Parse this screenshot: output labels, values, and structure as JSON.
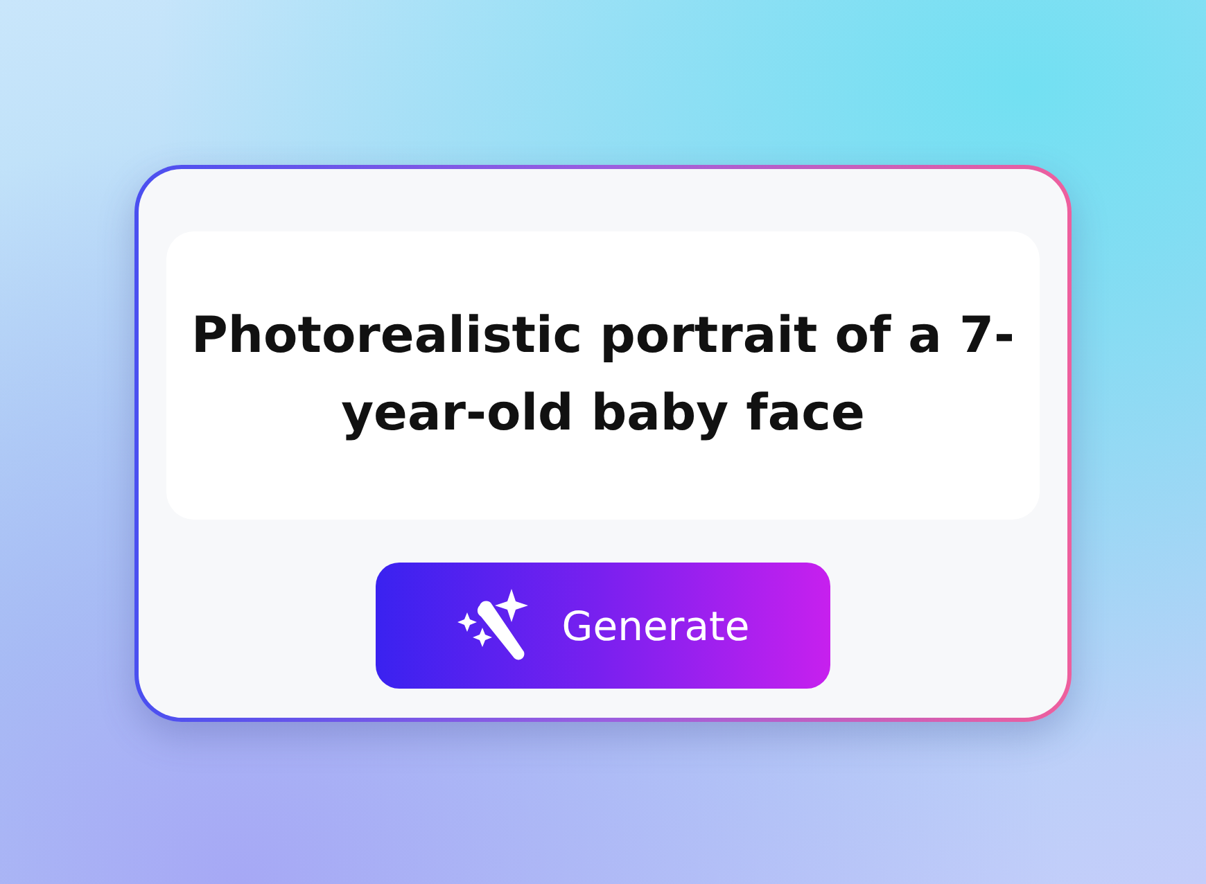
{
  "prompt": "Photorealistic portrait of a 7-year-old baby face",
  "button": {
    "label": "Generate"
  }
}
